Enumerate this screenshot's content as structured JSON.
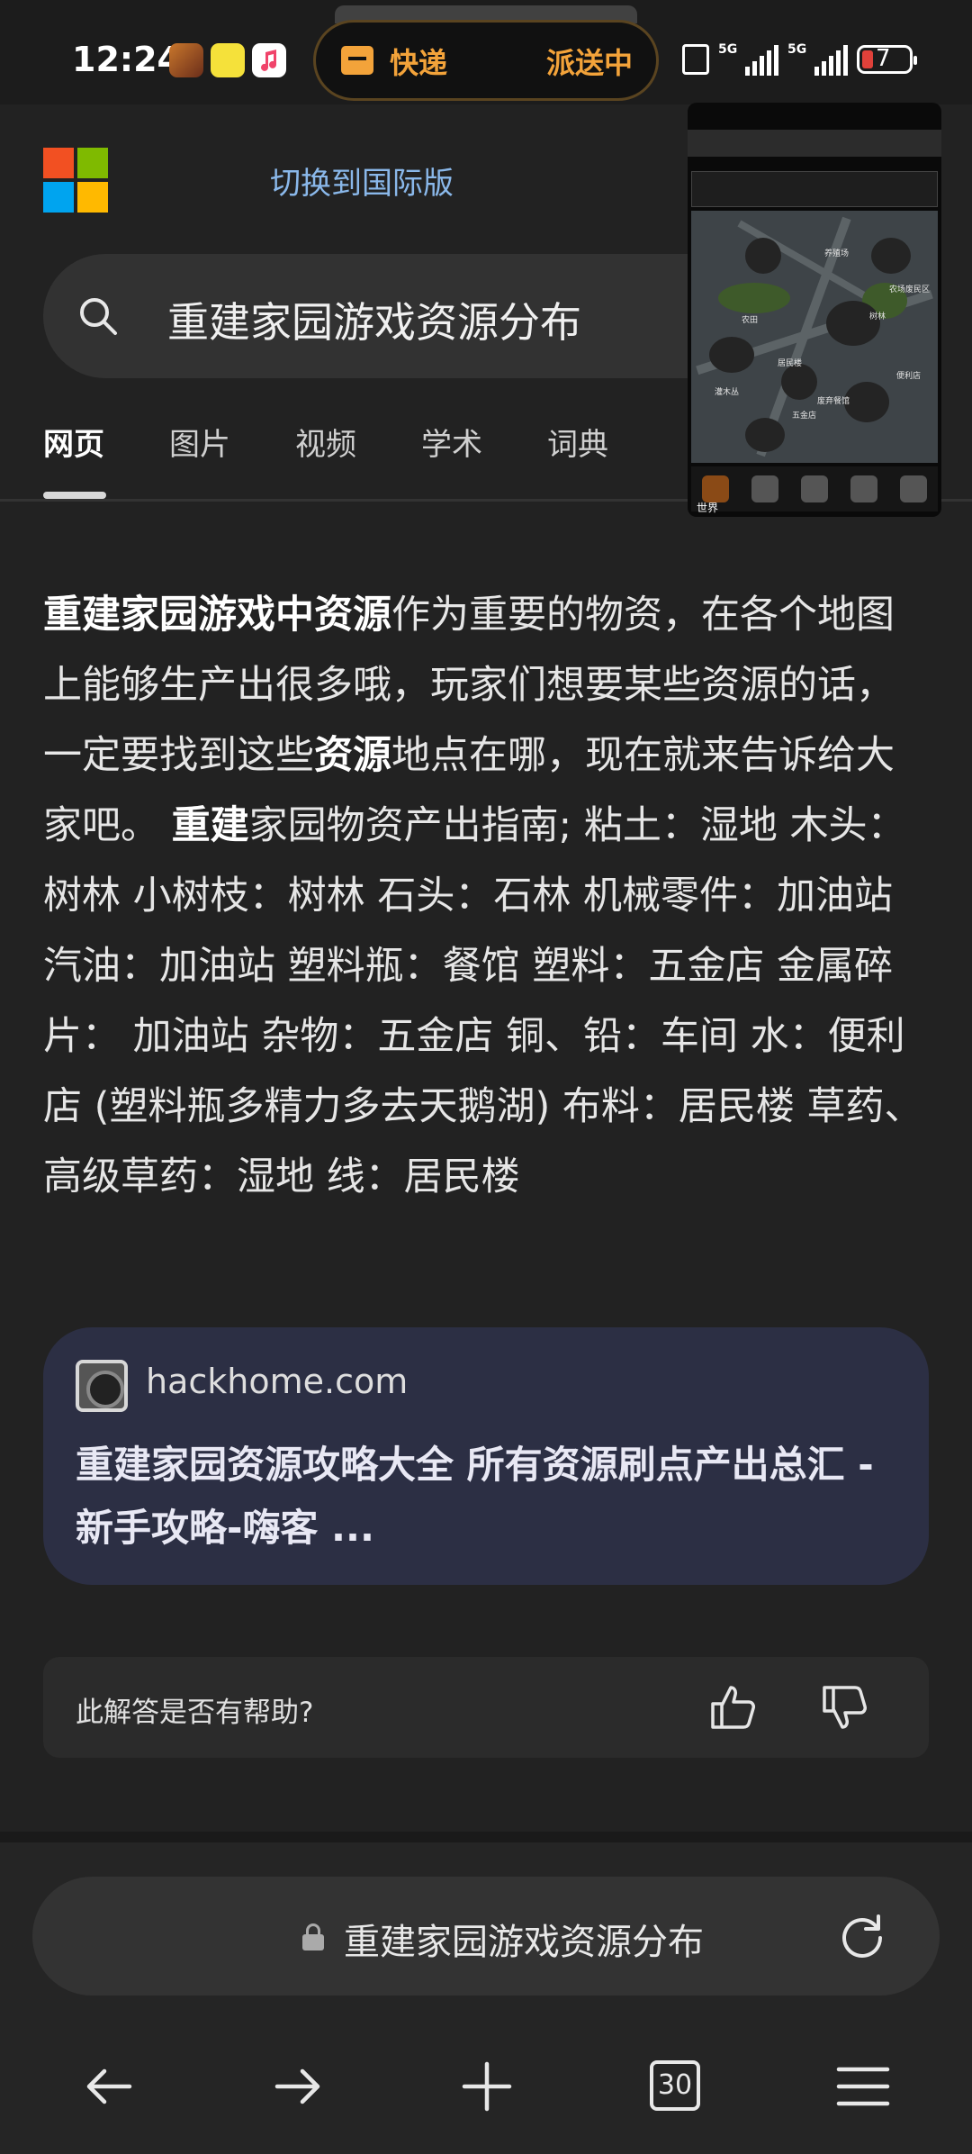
{
  "status_bar": {
    "time": "12:24",
    "notification": {
      "label": "快递",
      "status": "派送中"
    },
    "network": [
      "5G",
      "5G"
    ],
    "battery": "7"
  },
  "header": {
    "switch_label": "切换到国际版"
  },
  "search": {
    "query": "重建家园游戏资源分布"
  },
  "tabs": [
    {
      "label": "网页",
      "active": true
    },
    {
      "label": "图片",
      "active": false
    },
    {
      "label": "视频",
      "active": false
    },
    {
      "label": "学术",
      "active": false
    },
    {
      "label": "词典",
      "active": false
    }
  ],
  "thumbnail": {
    "map_labels": [
      "养殖场",
      "农场废民区",
      "农田",
      "树林",
      "居民楼",
      "便利店",
      "灌木丛",
      "废弃餐馆",
      "五金店"
    ],
    "bottom_label": "世界"
  },
  "answer": {
    "part1_bold": "重建家园游戏中资源",
    "part2": "作为重要的物资，在各个地图上能够生产出很多哦，玩家们想要某些资源的话，一定要找到这些",
    "part3_bold": "资源",
    "part4": "地点在哪，现在就来告诉给大家吧。 ",
    "part5_bold": "重建",
    "part6": "家园物资产出指南; 粘土：湿地 木头：树林 小树枝：树林 石头：石林 机械零件：加油站 汽油：加油站 塑料瓶：餐馆 塑料：五金店 金属碎片： 加油站 杂物：五金店 铜、铅：车间 水：便利店 (塑料瓶多精力多去天鹅湖) 布料：居民楼 草药、高级草药：湿地 线：居民楼"
  },
  "source": {
    "domain": "hackhome.com",
    "title": "重建家园资源攻略大全 所有资源刷点产出总汇 -新手攻略-嗨客 ..."
  },
  "feedback": {
    "question": "此解答是否有帮助?"
  },
  "address_bar": {
    "url_text": "重建家园游戏资源分布"
  },
  "bottom_nav": {
    "tab_count": "30"
  },
  "colors": {
    "accent_link": "#8ab8ea",
    "notification": "#f3a33a",
    "card_bg": "#2c2f44",
    "ms_red": "#f25022",
    "ms_green": "#7fba00",
    "ms_blue": "#00a4ef",
    "ms_yellow": "#ffb900"
  }
}
